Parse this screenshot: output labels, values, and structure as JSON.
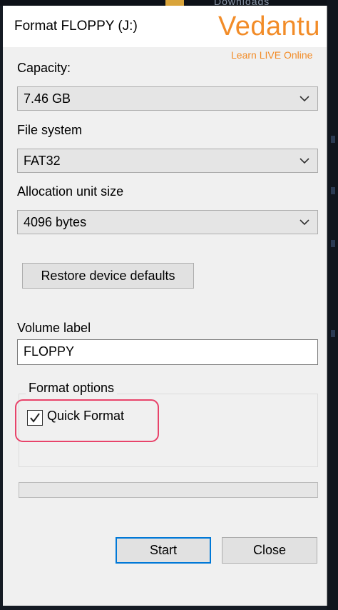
{
  "background": {
    "top_text": "Downloads"
  },
  "window": {
    "title": "Format FLOPPY (J:)"
  },
  "watermark": {
    "brand": "Vedantu",
    "tagline": "Learn LIVE Online",
    "color": "#f28c28"
  },
  "capacity": {
    "label": "Capacity:",
    "value": "7.46 GB"
  },
  "file_system": {
    "label": "File system",
    "value": "FAT32"
  },
  "allocation": {
    "label": "Allocation unit size",
    "value": "4096 bytes"
  },
  "restore_button": {
    "label": "Restore device defaults"
  },
  "volume": {
    "label": "Volume label",
    "value": "FLOPPY"
  },
  "format_options": {
    "title": "Format options",
    "quick_format": {
      "label": "Quick Format",
      "checked": true
    }
  },
  "progress": {
    "value": 0
  },
  "buttons": {
    "start": "Start",
    "close": "Close"
  },
  "colors": {
    "highlight": "#e8436a",
    "default_button_border": "#0078d7"
  }
}
